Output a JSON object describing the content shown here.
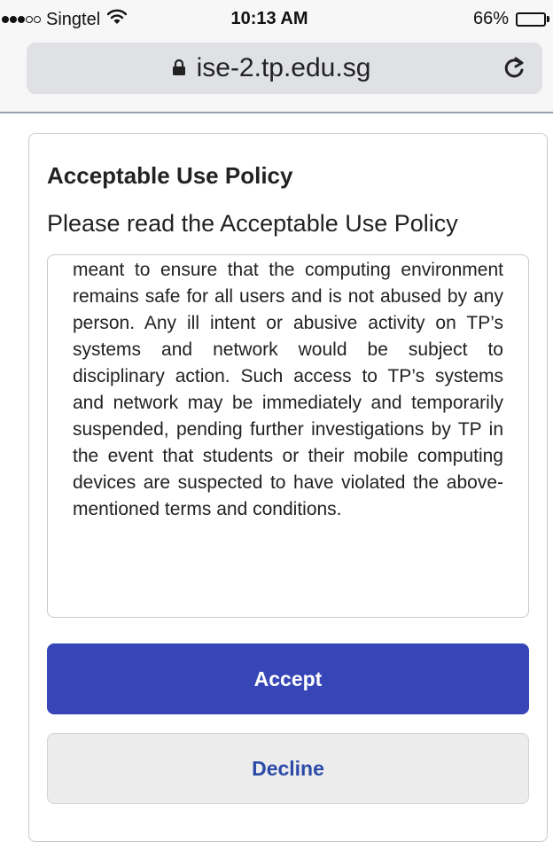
{
  "status_bar": {
    "carrier": "Singtel",
    "time": "10:13 AM",
    "battery": "66%",
    "battery_level": 0.66
  },
  "browser": {
    "url": "ise-2.tp.edu.sg"
  },
  "card": {
    "title": "Acceptable Use Policy",
    "subtitle": "Please read the Acceptable Use Policy",
    "policy_text": "meant to ensure that the computing environment remains safe for all users and is not abused by any person. Any ill intent or abusive activity on TP’s systems and network would be subject to disciplinary action. Such access to TP’s systems and network may be immediately and temporarily suspended, pending further investigations by TP in the event that students or their mobile computing devices are suspected to have violated the above-mentioned terms and conditions.",
    "accept_label": "Accept",
    "decline_label": "Decline"
  },
  "colors": {
    "accept_bg": "#3746b6",
    "decline_text": "#2c4aa8"
  }
}
